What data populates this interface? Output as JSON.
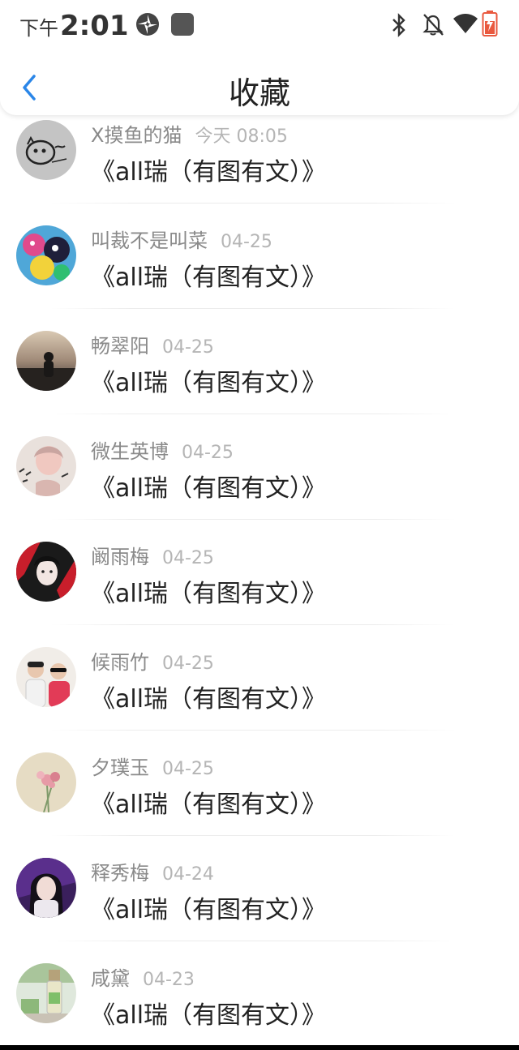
{
  "status_bar": {
    "ampm": "下午",
    "time": "2:01",
    "icons": [
      "sync-icon",
      "app-square-icon",
      "bluetooth-icon",
      "mute-bell-icon",
      "wifi-icon",
      "battery-charging-icon"
    ]
  },
  "header": {
    "back_icon": "chevron-left-icon",
    "title": "收藏"
  },
  "colors": {
    "accent": "#2a86e8",
    "name_text": "#8a8a8a",
    "date_text": "#b5b5b5",
    "title_text": "#222222",
    "battery": "#e9593f"
  },
  "favorites": [
    {
      "name": "X摸鱼的猫",
      "date": "今天 08:05",
      "title": "《all瑞（有图有文）》",
      "avatar": "sketch-cat-avatar"
    },
    {
      "name": "叫裁不是叫菜",
      "date": "04-25",
      "title": "《all瑞（有图有文）》",
      "avatar": "colorful-anime-avatar"
    },
    {
      "name": "畅翠阳",
      "date": "04-25",
      "title": "《all瑞（有图有文）》",
      "avatar": "sunset-silhouette-avatar"
    },
    {
      "name": "微生英博",
      "date": "04-25",
      "title": "《all瑞（有图有文）》",
      "avatar": "calligraphy-girl-avatar"
    },
    {
      "name": "阚雨梅",
      "date": "04-25",
      "title": "《all瑞（有图有文）》",
      "avatar": "red-black-portrait-avatar"
    },
    {
      "name": "候雨竹",
      "date": "04-25",
      "title": "《all瑞（有图有文）》",
      "avatar": "two-people-avatar"
    },
    {
      "name": "夕璞玉",
      "date": "04-25",
      "title": "《all瑞（有图有文）》",
      "avatar": "pink-flower-avatar"
    },
    {
      "name": "释秀梅",
      "date": "04-24",
      "title": "《all瑞（有图有文）》",
      "avatar": "purple-portrait-avatar"
    },
    {
      "name": "咸黛",
      "date": "04-23",
      "title": "《all瑞（有图有文）》",
      "avatar": "bottle-still-life-avatar"
    }
  ]
}
